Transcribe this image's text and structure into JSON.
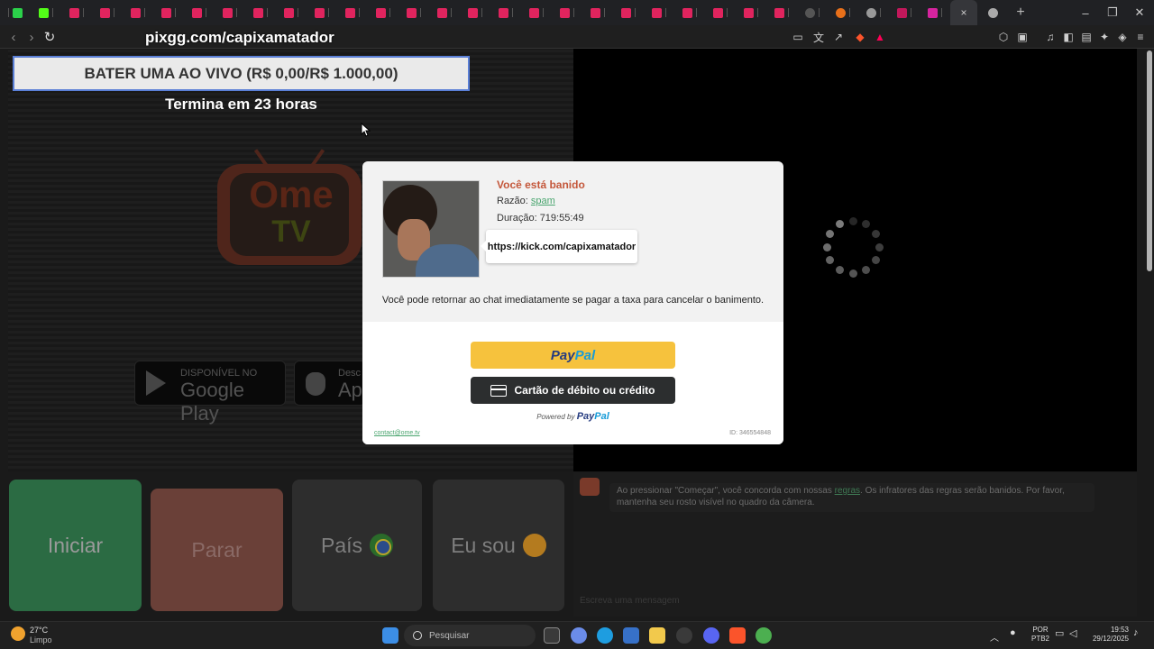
{
  "browser": {
    "url_overlay": "pixgg.com/capixamatador",
    "new_tab": "+",
    "close_tab": "×",
    "minimize": "–",
    "maximize": "❐",
    "close_window": "✕"
  },
  "promo": {
    "title": "BATER UMA AO VIVO (R$ 0,00/R$ 1.000,00)",
    "timer": "Termina em 23 horas"
  },
  "logo": {
    "ome": "Ome",
    "tv": "TV"
  },
  "stores": {
    "google_small": "DISPONÍVEL NO",
    "google_big": "Google Play",
    "apple_small": "Desc",
    "apple_big": "Ap"
  },
  "ban": {
    "title": "Você está banido",
    "reason_label": "Razão: ",
    "reason_value": "spam",
    "duration": "Duração: 719:55:49",
    "bubble_link": "https://kick.com/capixamatador",
    "message": "Você pode retornar ao chat imediatamente se pagar a taxa para cancelar o banimento.",
    "paypal_pay": "Pay",
    "paypal_pal": "Pal",
    "card_label": "Cartão de débito ou crédito",
    "powered_by": "Powered by ",
    "contact": "contact@ome.tv",
    "id": "ID: 346554848"
  },
  "controls": {
    "start": "Iniciar",
    "stop": "Parar",
    "country": "País",
    "gender": "Eu sou"
  },
  "chat": {
    "rules_before": "Ao pressionar \"Começar\", você concorda com nossas ",
    "rules_link": "regras",
    "rules_after": ". Os infratores das regras serão banidos. Por favor, mantenha seu rosto visível no quadro da câmera.",
    "input_placeholder": "Escreva uma mensagem"
  },
  "taskbar": {
    "weather_temp": "27°C",
    "weather_desc": "Limpo",
    "search_placeholder": "Pesquisar",
    "lang_top": "POR",
    "lang_bottom": "PTB2",
    "time": "19:53",
    "date": "29/12/2025"
  },
  "colors": {
    "ban_title": "#c4573a",
    "paypal_yellow": "#f6c23d",
    "link_green": "#49a56e",
    "promo_border": "#5a7fd6"
  }
}
